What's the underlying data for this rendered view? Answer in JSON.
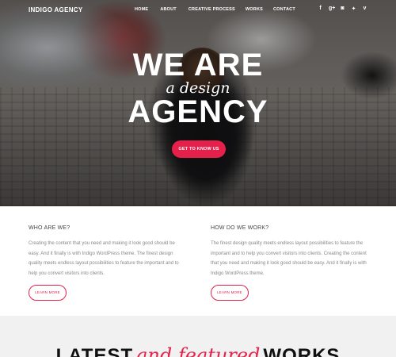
{
  "brand": {
    "name": "INDIGO AGENCY",
    "accent": "#e5214b"
  },
  "nav": {
    "items": [
      {
        "label": "HOME"
      },
      {
        "label": "ABOUT"
      },
      {
        "label": "CREATIVE PROCESS"
      },
      {
        "label": "WORKS"
      },
      {
        "label": "CONTACT"
      }
    ]
  },
  "social": [
    {
      "icon": "facebook-icon",
      "glyph": "f"
    },
    {
      "icon": "google-plus-icon",
      "glyph": "g+"
    },
    {
      "icon": "instagram-icon",
      "glyph": "◙"
    },
    {
      "icon": "twitter-icon",
      "glyph": "✦"
    },
    {
      "icon": "vimeo-icon",
      "glyph": "v"
    }
  ],
  "hero": {
    "line1": "WE ARE",
    "line2": "a design",
    "line3": "AGENCY",
    "cta": "GET TO KNOW US"
  },
  "info": {
    "left": {
      "heading": "WHO ARE WE?",
      "body": "Creating the content that you need and making it look good should be easy. And it finally is with Indigo WordPress theme. The finest design quality meets endless layout possibilities to feature the important and to help you convert visitors into clients.",
      "button": "LEARN MORE"
    },
    "right": {
      "heading": "HOW DO WE WORK?",
      "body": "The finest design quality meets endless layout possibilities to feature the important and to help you convert visitors into clients. Creating the content that you need and making it look good should be easy. And it finally is with Indigo WordPress theme.",
      "button": "LEARN MORE"
    }
  },
  "works": {
    "title_a": "LATEST",
    "title_b": "and featured",
    "title_c": "WORKS"
  }
}
